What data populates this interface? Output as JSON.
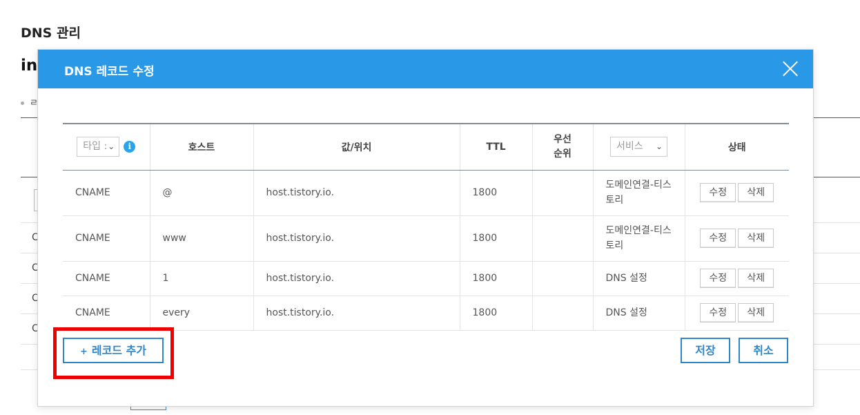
{
  "background": {
    "title": "DNS 관리",
    "domain_peek": "in",
    "bullet_peek": "ㄹ",
    "row_peek": "C"
  },
  "modal": {
    "title": "DNS 레코드 수정",
    "close_icon": "close-icon",
    "header_color": "#2998e6",
    "columns": {
      "type_placeholder": "타입 :",
      "info_icon": "i",
      "host": "호스트",
      "value": "값/위치",
      "ttl": "TTL",
      "priority_line1": "우선",
      "priority_line2": "순위",
      "service_placeholder": "서비스",
      "status": "상태"
    },
    "rows": [
      {
        "type": "CNAME",
        "host": "@",
        "value": "host.tistory.io.",
        "ttl": "1800",
        "priority": "",
        "service": "도메인연결-티스토리",
        "edit": "수정",
        "delete": "삭제"
      },
      {
        "type": "CNAME",
        "host": "www",
        "value": "host.tistory.io.",
        "ttl": "1800",
        "priority": "",
        "service": "도메인연결-티스토리",
        "edit": "수정",
        "delete": "삭제"
      },
      {
        "type": "CNAME",
        "host": "1",
        "value": "host.tistory.io.",
        "ttl": "1800",
        "priority": "",
        "service": "DNS 설정",
        "edit": "수정",
        "delete": "삭제"
      },
      {
        "type": "CNAME",
        "host": "every",
        "value": "host.tistory.io.",
        "ttl": "1800",
        "priority": "",
        "service": "DNS 설정",
        "edit": "수정",
        "delete": "삭제"
      }
    ],
    "add_record_plus": "+",
    "add_record_label": "레코드 추가",
    "save_label": "저장",
    "cancel_label": "취소",
    "highlight_color": "#ee0000"
  }
}
